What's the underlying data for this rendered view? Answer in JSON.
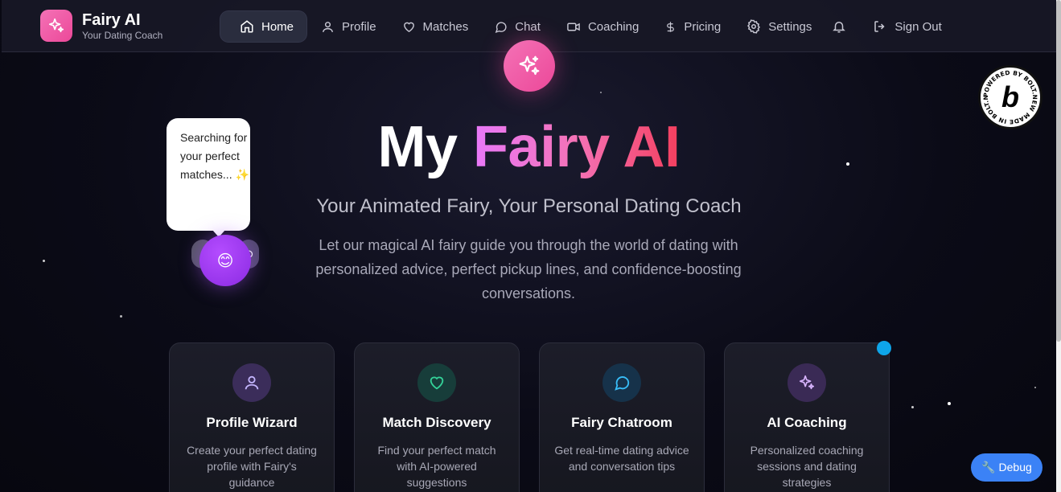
{
  "brand": {
    "name": "Fairy AI",
    "tagline": "Your Dating Coach",
    "logo_icon": "sparkles-icon",
    "accent": "#ec4899"
  },
  "nav": {
    "items": [
      {
        "label": "Home",
        "icon": "home-icon",
        "active": true
      },
      {
        "label": "Profile",
        "icon": "user-icon"
      },
      {
        "label": "Matches",
        "icon": "heart-icon"
      },
      {
        "label": "Chat",
        "icon": "chat-bubble-icon"
      },
      {
        "label": "Coaching",
        "icon": "video-icon"
      },
      {
        "label": "Pricing",
        "icon": "dollar-icon"
      },
      {
        "label": "Settings",
        "icon": "gear-icon"
      }
    ],
    "notifications_icon": "bell-icon",
    "sign_out": {
      "label": "Sign Out",
      "icon": "sign-out-icon"
    }
  },
  "hero": {
    "title_plain": "My ",
    "title_accent": "Fairy AI",
    "subtitle": "Your Animated Fairy, Your Personal Dating Coach",
    "description": "Let our magical AI fairy guide you through the world of dating with personalized advice, perfect pickup lines, and confidence-boosting conversations."
  },
  "fairy": {
    "bubble_text": "Searching for your perfect matches... ✨",
    "face": "😊"
  },
  "bolt_badge": {
    "ring_text": "POWERED BY BOLT.NEW MADE IN BOLT.NEW",
    "letter": "b"
  },
  "cards": [
    {
      "title": "Profile Wizard",
      "desc": "Create your perfect dating profile with Fairy's guidance",
      "icon": "user-icon",
      "color": "#a78bfa"
    },
    {
      "title": "Match Discovery",
      "desc": "Find your perfect match with AI-powered suggestions",
      "icon": "heart-icon",
      "color": "#34d399"
    },
    {
      "title": "Fairy Chatroom",
      "desc": "Get real-time dating advice and conversation tips",
      "icon": "chat-bubble-icon",
      "color": "#38bdf8"
    },
    {
      "title": "AI Coaching",
      "desc": "Personalized coaching sessions and dating strategies",
      "icon": "sparkles-icon",
      "color": "#c084fc"
    }
  ],
  "debug": {
    "label": "🔧 Debug"
  }
}
